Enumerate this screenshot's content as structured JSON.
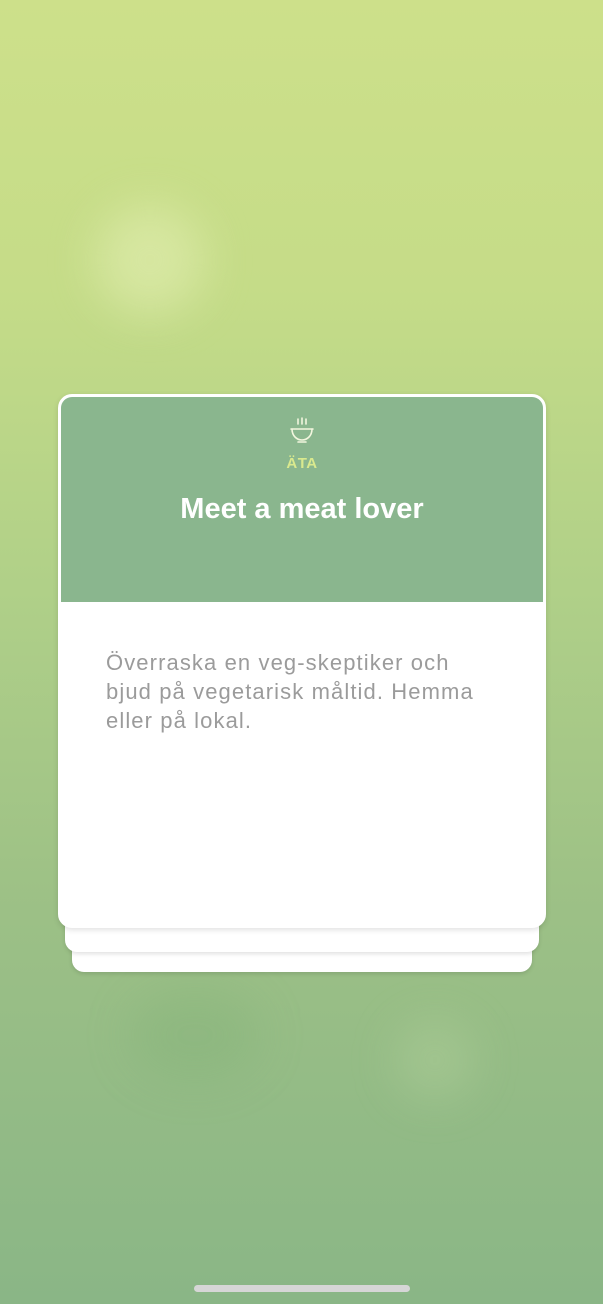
{
  "card": {
    "category": "ÄTA",
    "title": "Meet a meat lover",
    "description": "Överraska en veg-skeptiker och bjud på vegetarisk måltid. Hemma eller på lokal.",
    "icon": "bowl-icon"
  },
  "colors": {
    "header_bg": "#8ab68e",
    "category_text": "#d9e98e",
    "title_text": "#ffffff",
    "description_text": "#9b9b9b"
  }
}
